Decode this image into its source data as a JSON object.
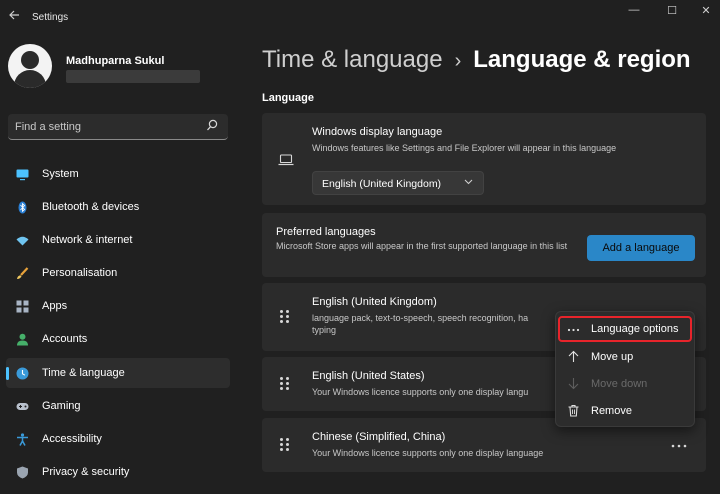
{
  "window": {
    "title": "Settings",
    "minimize": "—",
    "maximize": "☐",
    "close": "✕"
  },
  "user": {
    "name": "Madhuparna Sukul"
  },
  "search": {
    "placeholder": "Find a setting"
  },
  "sidebar": {
    "items": [
      {
        "label": "System",
        "icon": "monitor-icon"
      },
      {
        "label": "Bluetooth & devices",
        "icon": "bluetooth-icon"
      },
      {
        "label": "Network & internet",
        "icon": "wifi-icon"
      },
      {
        "label": "Personalisation",
        "icon": "brush-icon"
      },
      {
        "label": "Apps",
        "icon": "apps-icon"
      },
      {
        "label": "Accounts",
        "icon": "person-icon"
      },
      {
        "label": "Time & language",
        "icon": "globe-clock-icon",
        "active": true
      },
      {
        "label": "Gaming",
        "icon": "gamepad-icon"
      },
      {
        "label": "Accessibility",
        "icon": "accessibility-icon"
      },
      {
        "label": "Privacy & security",
        "icon": "shield-icon"
      }
    ]
  },
  "header": {
    "crumb": "Time & language",
    "separator": "›",
    "current": "Language & region"
  },
  "language_section": {
    "label": "Language",
    "display_language": {
      "title": "Windows display language",
      "description": "Windows features like Settings and File Explorer will appear in this language",
      "selected": "English (United Kingdom)"
    },
    "preferred": {
      "title": "Preferred languages",
      "description": "Microsoft Store apps will appear in the first supported language in this list",
      "add_button": "Add a language"
    },
    "languages": [
      {
        "name": "English (United Kingdom)",
        "detail": "language pack, text-to-speech, speech recognition, ha",
        "detail2": "typing"
      },
      {
        "name": "English (United States)",
        "detail": "Your Windows licence supports only one display langu"
      },
      {
        "name": "Chinese (Simplified, China)",
        "detail": "Your Windows licence supports only one display language"
      }
    ]
  },
  "context_menu": {
    "items": [
      {
        "label": "Language options",
        "icon": "more-icon",
        "highlighted": true
      },
      {
        "label": "Move up",
        "icon": "arrow-up-icon"
      },
      {
        "label": "Move down",
        "icon": "arrow-down-icon",
        "disabled": true
      },
      {
        "label": "Remove",
        "icon": "trash-icon"
      }
    ]
  },
  "colors": {
    "accent": "#4cc2ff",
    "button": "#2a87c8",
    "highlight_border": "#e8242b",
    "background": "#202020",
    "card": "#2b2b2b"
  }
}
